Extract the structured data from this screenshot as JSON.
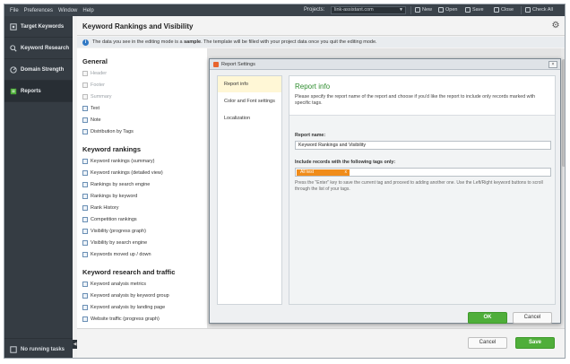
{
  "menu": {
    "items": [
      "File",
      "Preferences",
      "Window",
      "Help"
    ],
    "projects_label": "Projects:",
    "project_value": "link-assistant.com",
    "toolbar": [
      "New",
      "Open",
      "Save",
      "Close",
      "Check All"
    ]
  },
  "sidebar": {
    "items": [
      {
        "label": "Target Keywords",
        "icon": "target-icon"
      },
      {
        "label": "Keyword Research",
        "icon": "magnifier-icon"
      },
      {
        "label": "Domain Strength",
        "icon": "gauge-icon"
      },
      {
        "label": "Reports",
        "icon": "report-icon"
      }
    ],
    "active_index": 3,
    "bottom_label": "No running tasks"
  },
  "page": {
    "title": "Keyword Rankings and Visibility",
    "info_prefix": "The data you see in the editing mode is a ",
    "info_bold": "sample",
    "info_suffix": ". The template will be filled with your project data once you quit the editing mode."
  },
  "templates": {
    "sections": [
      {
        "title": "General",
        "items": [
          "Header",
          "Footer",
          "Summary",
          "Text",
          "Note",
          "Distribution by Tags"
        ],
        "muted": [
          0,
          1,
          2
        ]
      },
      {
        "title": "Keyword rankings",
        "items": [
          "Keyword rankings (summary)",
          "Keyword rankings (detailed view)",
          "Rankings by search engine",
          "Rankings by keyword",
          "Rank History",
          "Competition rankings",
          "Visibility (progress graph)",
          "Visibility by search engine",
          "Keywords moved up / down"
        ],
        "muted": []
      },
      {
        "title": "Keyword research and traffic",
        "items": [
          "Keyword analysis metrics",
          "Keyword analysis by keyword group",
          "Keyword analysis by landing page",
          "Website traffic (progress graph)"
        ],
        "muted": []
      }
    ]
  },
  "footer": {
    "cancel_label": "Cancel",
    "save_label": "Save"
  },
  "dialog": {
    "title": "Report Settings",
    "close_label": "×",
    "tabs": [
      "Report info",
      "Color and Font settings",
      "Localization"
    ],
    "active_tab": 0,
    "heading": "Report info",
    "description": "Please specify the report name of the report and choose if you'd like the report to include only records marked with specific tags.",
    "report_name_label": "Report name:",
    "report_name_value": "Keyword Rankings and Visibility",
    "tags_label": "Include records with the following tags only:",
    "tag_chip": "All test",
    "tag_remove": "x",
    "hint": "Press the \"Enter\" key to save the current tag and proceed to adding another one. Use the Left/Right keyword buttons to scroll through the list of your tags.",
    "ok_label": "OK",
    "cancel_label": "Cancel"
  },
  "colors": {
    "accent_green": "#4fae3a",
    "tag_orange": "#f08c1a",
    "sidebar_bg": "#353c43",
    "info_blue": "#2f78c4"
  }
}
